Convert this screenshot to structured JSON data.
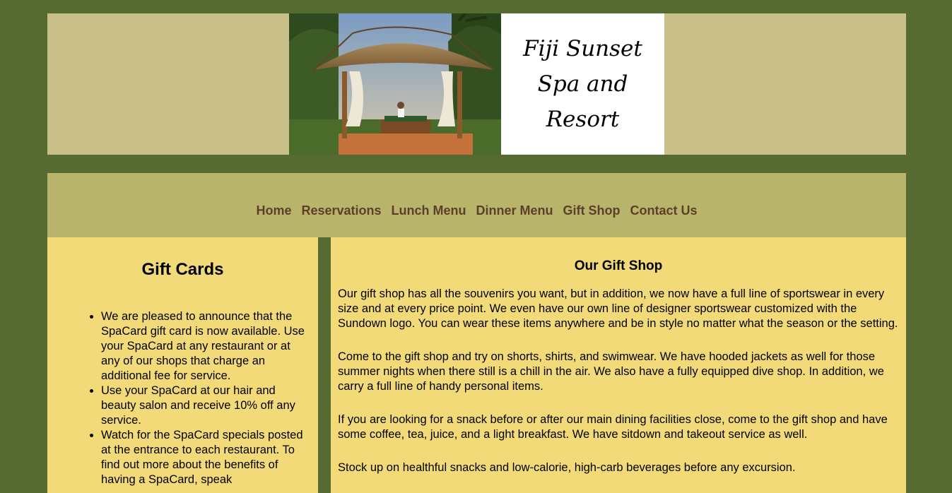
{
  "header": {
    "logo_line1": "Fiji Sunset",
    "logo_line2": "Spa and Resort"
  },
  "nav": {
    "items": [
      {
        "label": "Home"
      },
      {
        "label": "Reservations"
      },
      {
        "label": "Lunch Menu"
      },
      {
        "label": "Dinner Menu"
      },
      {
        "label": "Gift Shop"
      },
      {
        "label": "Contact Us"
      }
    ]
  },
  "sidebar": {
    "title": "Gift Cards",
    "items": [
      "We are pleased to announce that the SpaCard gift card is now available. Use your SpaCard at any restaurant or at any of our shops that charge an additional fee for service.",
      "Use your SpaCard at our hair and beauty salon and receive 10% off any service.",
      "Watch for the SpaCard specials posted at the entrance to each restaurant. To find out more about the benefits of having a SpaCard, speak"
    ]
  },
  "main": {
    "title": "Our Gift Shop",
    "paragraphs": [
      "Our gift shop has all the souvenirs you want, but in addition, we now have a full line of sportswear in every size and at every price point. We even have our own line of designer sportswear customized with the Sundown logo. You can wear these items anywhere and be in style no matter what the season or the setting.",
      "Come to the gift shop and try on shorts, shirts, and swimwear. We have hooded jackets as well for those summer nights when there still is a chill in the air. We also have a fully equipped dive shop. In addition, we carry a full line of handy personal items.",
      "If you are looking for a snack before or after our main dining facilities close, come to the gift shop and have some coffee, tea, juice, and a light breakfast. We have sitdown and takeout service as well.",
      "Stock up on healthful snacks and low-calorie, high-carb beverages before any excursion."
    ]
  },
  "colors": {
    "page_bg": "#556b31",
    "header_bg": "#c9bf89",
    "nav_bg": "#b9b46b",
    "content_bg": "#f2da79",
    "nav_link": "#5c3f28"
  }
}
